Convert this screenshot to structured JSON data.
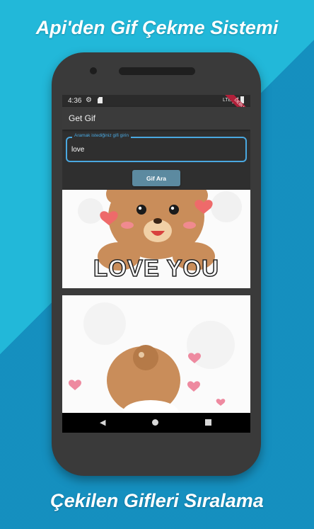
{
  "banner": {
    "top_title": "Api'den Gif Çekme Sistemi",
    "bottom_title": "Çekilen Gifleri Sıralama"
  },
  "status_bar": {
    "time": "4:36",
    "network": "LTE",
    "debug_label": "DEBUG"
  },
  "app_bar": {
    "title": "Get Gif"
  },
  "search": {
    "label": "Aramak istediğiniz gifi girin",
    "value": "love",
    "button_label": "Gif Ara"
  },
  "gif_results": [
    {
      "caption": "LOVE YOU"
    },
    {
      "caption": ""
    }
  ],
  "icons": {
    "settings": "gear-icon",
    "sd_card": "sd-card-icon",
    "signal": "signal-icon",
    "battery": "battery-icon",
    "nav_back": "back-icon",
    "nav_home": "home-icon",
    "nav_recent": "recent-apps-icon"
  },
  "colors": {
    "background": "#22b8d9",
    "phone_body": "#3a3a3a",
    "accent": "#4aa8e0",
    "button": "#5c8aa0",
    "debug_banner": "#b1203a"
  }
}
